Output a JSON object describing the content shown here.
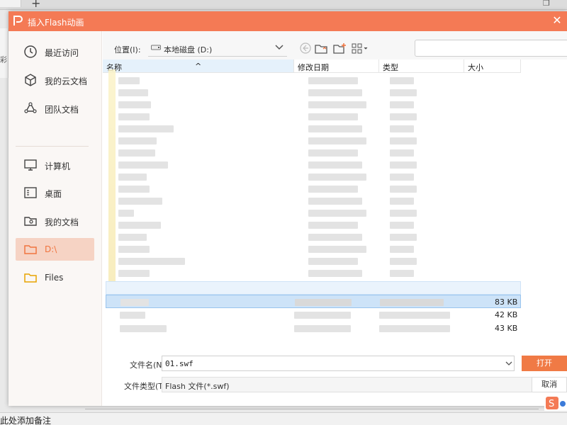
{
  "background": {
    "status_text": "此处添加备注",
    "side_text": "彩"
  },
  "dialog": {
    "title": "插入Flash动画",
    "accent_color": "#f47a55"
  },
  "nav": {
    "items": [
      {
        "label": "最近访问",
        "icon": "clock-icon"
      },
      {
        "label": "我的云文档",
        "icon": "cube-icon"
      },
      {
        "label": "团队文档",
        "icon": "team-cloud-icon"
      },
      {
        "label": "计算机",
        "icon": "monitor-icon"
      },
      {
        "label": "桌面",
        "icon": "desktop-icon"
      },
      {
        "label": "我的文档",
        "icon": "user-folder-icon"
      },
      {
        "label": "D:\\",
        "icon": "folder-icon",
        "active": true
      },
      {
        "label": "Files",
        "icon": "folder-icon"
      }
    ]
  },
  "toolbar": {
    "location_label": "位置(I):",
    "location_value": "本地磁盘 (D:)"
  },
  "table": {
    "columns": [
      "名称",
      "修改日期",
      "类型",
      "大小"
    ],
    "sizes": [
      "83 KB",
      "42 KB",
      "43 KB"
    ]
  },
  "form": {
    "filename_label": "文件名(N):",
    "filename_value": "01.swf",
    "filetype_label": "文件类型(T):",
    "filetype_value": "Flash 文件(*.swf)",
    "open_label": "打开",
    "cancel_label": "取消"
  }
}
